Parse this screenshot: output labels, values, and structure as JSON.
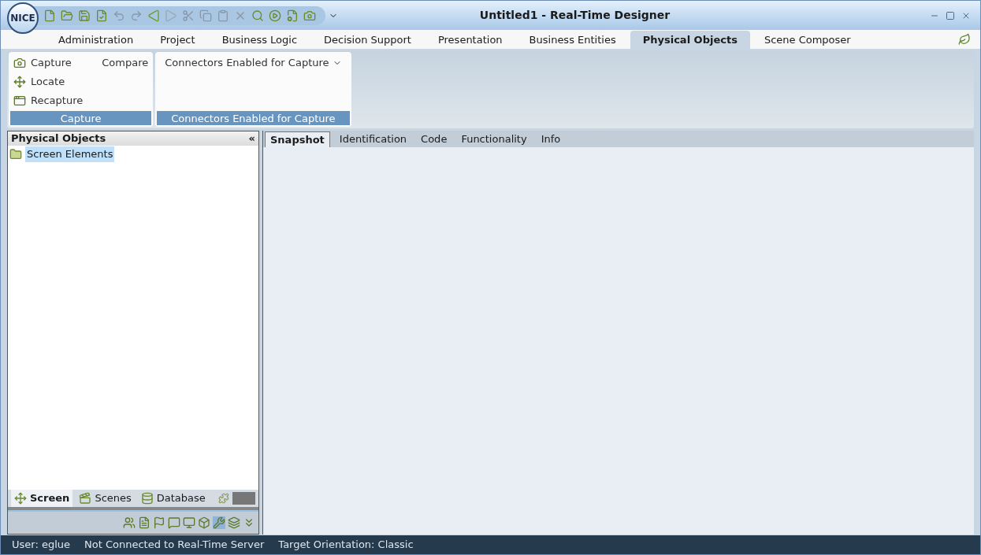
{
  "window": {
    "title": "Untitled1 - Real-Time Designer",
    "logo": "NICE"
  },
  "ribbon_tabs": [
    {
      "label": "Administration",
      "selected": false
    },
    {
      "label": "Project",
      "selected": false
    },
    {
      "label": "Business Logic",
      "selected": false
    },
    {
      "label": "Decision Support",
      "selected": false
    },
    {
      "label": "Presentation",
      "selected": false
    },
    {
      "label": "Business Entities",
      "selected": false
    },
    {
      "label": "Physical Objects",
      "selected": true
    },
    {
      "label": "Scene Composer",
      "selected": false
    }
  ],
  "ribbon_groups": [
    {
      "title": "Capture",
      "columns": [
        [
          "Capture",
          "Locate",
          "Recapture"
        ],
        [
          "Compare"
        ]
      ]
    },
    {
      "title": "Connectors Enabled for Capture",
      "dropdown": "Connectors Enabled for Capture"
    }
  ],
  "left_panel": {
    "title": "Physical Objects",
    "collapse": "«",
    "tree": [
      {
        "label": "Screen Elements",
        "selected": true
      }
    ],
    "bottom_tabs": [
      {
        "label": "Screen",
        "selected": true
      },
      {
        "label": "Scenes",
        "selected": false
      },
      {
        "label": "Database",
        "selected": false
      }
    ]
  },
  "content_tabs": [
    {
      "label": "Snapshot",
      "selected": true
    },
    {
      "label": "Identification",
      "selected": false
    },
    {
      "label": "Code",
      "selected": false
    },
    {
      "label": "Functionality",
      "selected": false
    },
    {
      "label": "Info",
      "selected": false
    }
  ],
  "status_bar": [
    "User: eglue",
    "Not Connected to Real-Time Server",
    "Target Orientation: Classic"
  ]
}
